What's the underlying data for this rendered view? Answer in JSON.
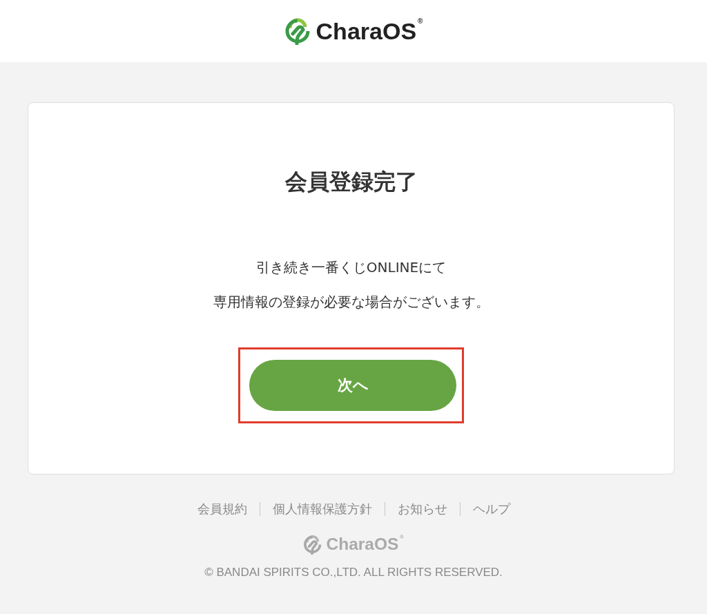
{
  "header": {
    "logo": {
      "text": "CharaOS",
      "mark": "®"
    }
  },
  "card": {
    "title": "会員登録完了",
    "message": [
      "引き続き一番くじONLINEにて",
      "専用情報の登録が必要な場合がございます。"
    ],
    "button": {
      "label": "次へ",
      "highlighted": true
    }
  },
  "footer": {
    "links": [
      "会員規約",
      "個人情報保護方針",
      "お知らせ",
      "ヘルプ"
    ],
    "logo": {
      "text": "CharaOS",
      "mark": "®"
    },
    "copyright": "© BANDAI SPIRITS CO.,LTD. ALL RIGHTS RESERVED."
  }
}
